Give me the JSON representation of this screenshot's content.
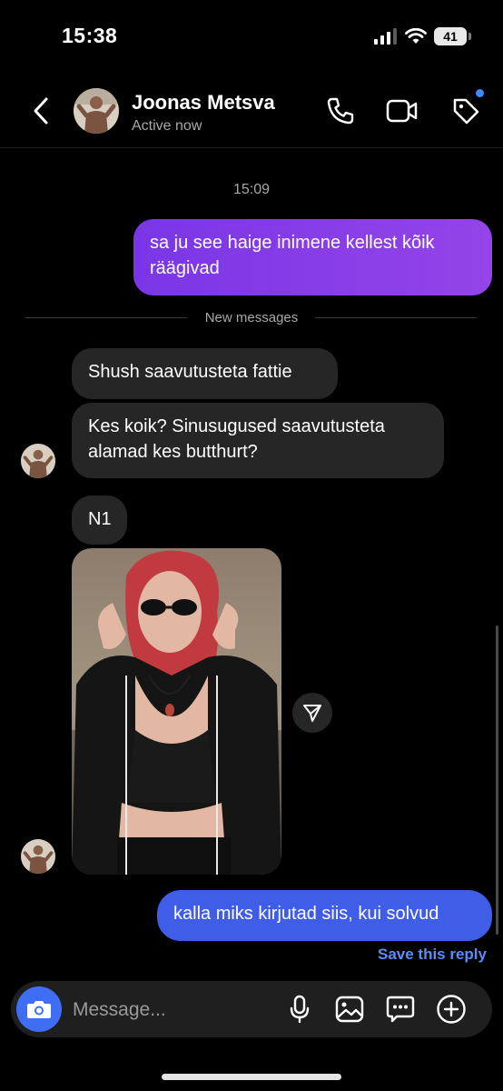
{
  "status_bar": {
    "time": "15:38",
    "battery": "41"
  },
  "header": {
    "contact_name": "Joonas Metsva",
    "contact_status": "Active now",
    "icons": [
      "back-chevron-icon",
      "phone-icon",
      "video-camera-icon",
      "tag-icon"
    ]
  },
  "thread": {
    "timestamp": "15:09",
    "outgoing_1": "sa ju see haige inimene kellest kõik räägivad",
    "new_messages_label": "New messages",
    "incoming": [
      {
        "text": "Shush saavutusteta fattie"
      },
      {
        "text": "Kes koik? Sinusugused saavutusteta alamad kes butthurt?"
      },
      {
        "text": "N1"
      }
    ],
    "outgoing_2": "kalla miks kirjutad siis, kui solvud",
    "save_reply": "Save this reply"
  },
  "composer": {
    "placeholder": "Message...",
    "icons": [
      "camera-icon",
      "microphone-icon",
      "image-icon",
      "sticker-chat-icon",
      "plus-circle-icon"
    ]
  },
  "colors": {
    "background": "#000000",
    "incoming_bubble": "#262626",
    "outgoing_purple": "#8a3ee8",
    "outgoing_blue": "#3f5de6",
    "link_blue": "#5b8ef5",
    "camera_button": "#3f6ef5"
  }
}
